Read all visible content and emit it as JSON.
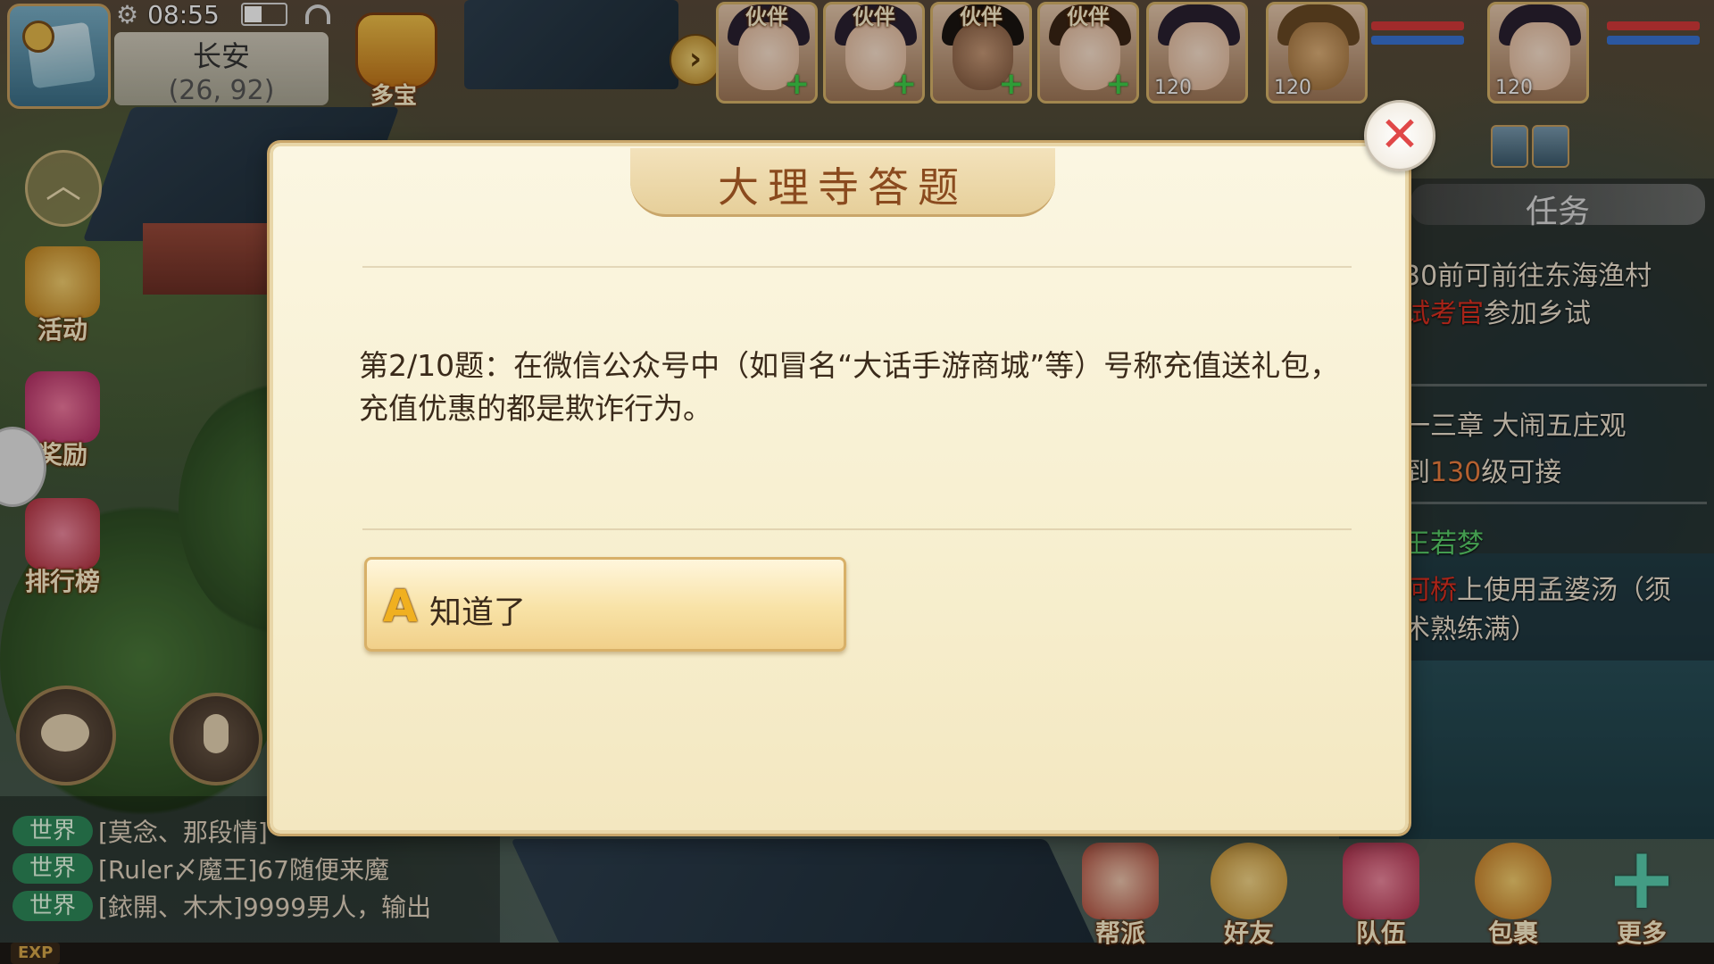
{
  "status": {
    "time": "08:55",
    "location_name": "长安",
    "location_coord": "(26, 92)",
    "duobao_label": "多宝"
  },
  "partners": [
    {
      "tag": "伙伴",
      "action": "+"
    },
    {
      "tag": "伙伴",
      "action": "+"
    },
    {
      "tag": "伙伴",
      "action": "+"
    },
    {
      "tag": "伙伴",
      "action": "+"
    }
  ],
  "team": [
    {
      "level": "120"
    },
    {
      "level": "120"
    },
    {
      "level": "120"
    }
  ],
  "side_menu": {
    "activity": "活动",
    "reward": "奖励",
    "ranking": "排行榜"
  },
  "chat": [
    {
      "channel": "世界",
      "text": "[莫念、那段情]"
    },
    {
      "channel": "世界",
      "text": "[Ruler〆魔王]67随便来魔"
    },
    {
      "channel": "世界",
      "text": "[銥開、木木]9999男人，输出"
    }
  ],
  "exp_label": "EXP",
  "quest": {
    "header": "任务",
    "lines": [
      {
        "prefix": "",
        "highlight": "",
        "text": "30前可前往东海渔村"
      },
      {
        "prefix": "",
        "highlight": "试考官",
        "text": "参加乡试"
      },
      {
        "prefix": "",
        "highlight": "",
        "text": "一三章 大闹五庄观"
      },
      {
        "prefix": "到",
        "highlight": "130",
        "text": "级可接"
      },
      {
        "prefix": "",
        "highlight": "",
        "text": "王若梦"
      },
      {
        "prefix": "",
        "highlight": "河桥",
        "text": "上使用孟婆汤（须"
      },
      {
        "prefix": "",
        "highlight": "",
        "text": "术熟练满）"
      }
    ]
  },
  "bottom_menu": {
    "guild": "帮派",
    "friends": "好友",
    "team": "队伍",
    "bag": "包裹",
    "more": "更多"
  },
  "dialog": {
    "title": "大理寺答题",
    "question": "第2/10题：在微信公众号中（如冒名“大话手游商城”等）号称充值送礼包，充值优惠的都是欺诈行为。",
    "answer_letter": "A",
    "answer_text": "知道了",
    "close_symbol": "✕"
  },
  "colors": {
    "dialog_bg": "#f7efcf",
    "title_color": "#8a4a1e",
    "close_x": "#e04848",
    "answer_letter": "#f0b020",
    "chat_channel": "#2e8a5a"
  }
}
